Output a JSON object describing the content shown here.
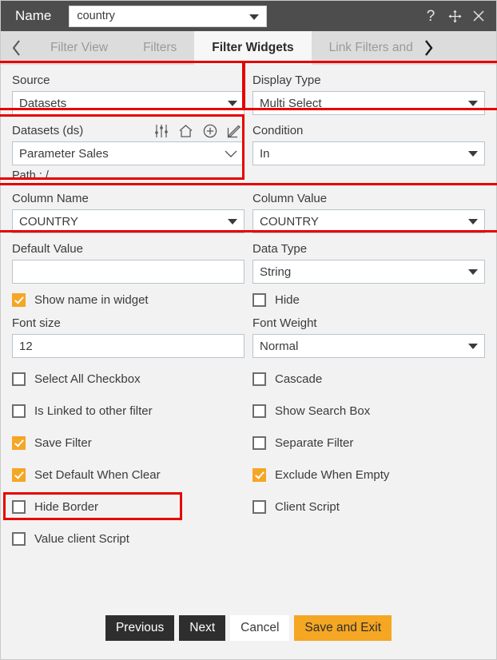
{
  "titlebar": {
    "name_label": "Name",
    "name_value": "country",
    "help_icon": "question-mark-icon",
    "move_icon": "move-arrows-icon",
    "close_icon": "close-icon"
  },
  "tabs": {
    "prev_arrow": "chevron-left-icon",
    "next_arrow": "chevron-right-icon",
    "items": [
      {
        "label": "Filter View",
        "active": false
      },
      {
        "label": "Filters",
        "active": false
      },
      {
        "label": "Filter Widgets",
        "active": true
      },
      {
        "label": "Link Filters and",
        "active": false
      }
    ]
  },
  "form": {
    "source": {
      "label": "Source",
      "value": "Datasets"
    },
    "display_type": {
      "label": "Display Type",
      "value": "Multi Select"
    },
    "datasets": {
      "label": "Datasets (ds)",
      "value": "Parameter Sales",
      "path": "Path : /",
      "icons": [
        "sliders-icon",
        "home-icon",
        "plus-circle-icon",
        "edit-pencil-icon"
      ]
    },
    "condition": {
      "label": "Condition",
      "value": "In"
    },
    "column_name": {
      "label": "Column Name",
      "value": "COUNTRY"
    },
    "column_value": {
      "label": "Column Value",
      "value": "COUNTRY"
    },
    "default_value": {
      "label": "Default Value",
      "value": ""
    },
    "data_type": {
      "label": "Data Type",
      "value": "String"
    },
    "font_size": {
      "label": "Font size",
      "value": "12"
    },
    "font_weight": {
      "label": "Font Weight",
      "value": "Normal"
    },
    "checkboxes": [
      {
        "label": "Show name in widget",
        "checked": true
      },
      {
        "label": "Hide",
        "checked": false
      },
      {
        "label": "Select All Checkbox",
        "checked": false
      },
      {
        "label": "Cascade",
        "checked": false
      },
      {
        "label": "Is Linked to other filter",
        "checked": false
      },
      {
        "label": "Show Search Box",
        "checked": false
      },
      {
        "label": "Save Filter",
        "checked": true
      },
      {
        "label": "Separate Filter",
        "checked": false
      },
      {
        "label": "Set Default When Clear",
        "checked": true
      },
      {
        "label": "Exclude When Empty",
        "checked": true
      },
      {
        "label": "Hide Border",
        "checked": false
      },
      {
        "label": "Client Script",
        "checked": false
      },
      {
        "label": "Value client Script",
        "checked": false
      }
    ]
  },
  "footer": {
    "previous": "Previous",
    "next": "Next",
    "cancel": "Cancel",
    "save_and_exit": "Save and Exit"
  },
  "colors": {
    "titlebar": "#4d4d4d",
    "accent": "#f5a623",
    "highlight": "#e60000",
    "tab_active_bg": "#f7f7f7",
    "tab_bg": "#dcdcdc"
  }
}
